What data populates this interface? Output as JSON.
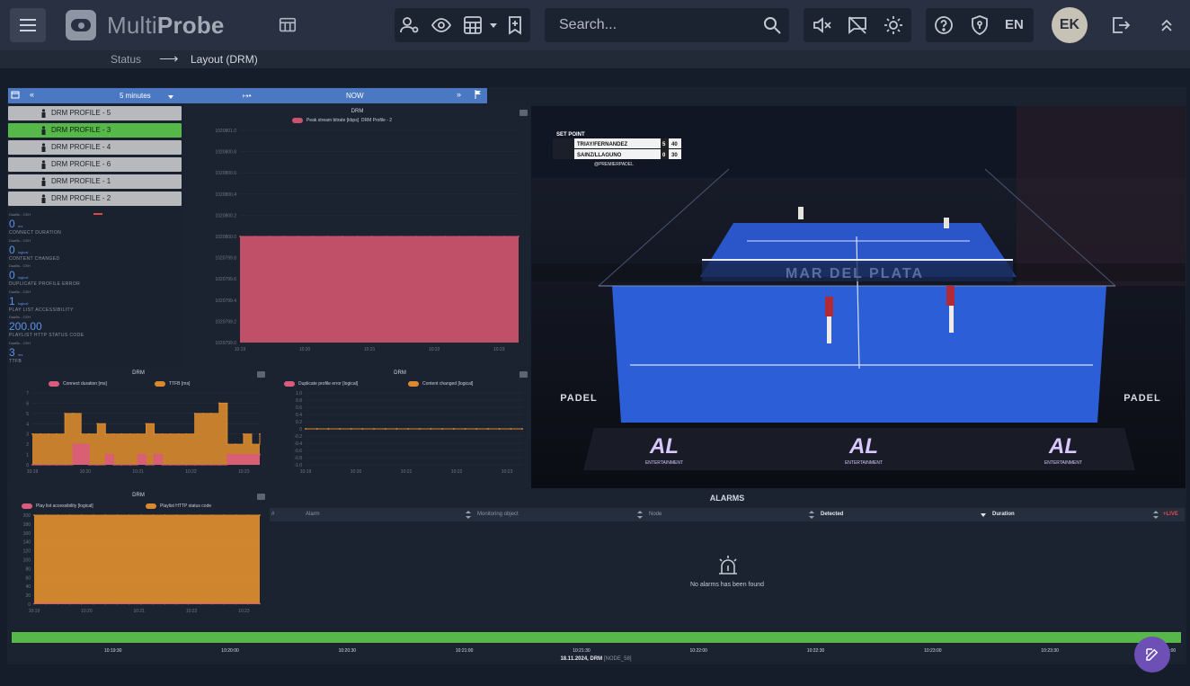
{
  "app": {
    "brand_light": "Multi",
    "brand_bold": "Probe",
    "search_placeholder": "Search...",
    "language": "EN",
    "user_initials": "EK"
  },
  "breadcrumb": {
    "parent": "Status",
    "current": "Layout (DRM)"
  },
  "timebar": {
    "range": "5 minutes",
    "now_label": "NOW"
  },
  "profiles": [
    {
      "label": "DRM PROFILE - 5",
      "active": false
    },
    {
      "label": "DRM PROFILE - 3",
      "active": true
    },
    {
      "label": "DRM PROFILE - 4",
      "active": false
    },
    {
      "label": "DRM PROFILE - 6",
      "active": false
    },
    {
      "label": "DRM PROFILE - 1",
      "active": false
    },
    {
      "label": "DRM PROFILE - 2",
      "active": false
    }
  ],
  "metrics": [
    {
      "small": "DaaBs - CEH",
      "value": "0",
      "unit": "ms",
      "label": "CONNECT DURATION",
      "flag": true
    },
    {
      "small": "DaaBs - CEH",
      "value": "0",
      "unit": "logical",
      "label": "CONTENT CHANGED",
      "flag": false
    },
    {
      "small": "DaaBs - CEH",
      "value": "0",
      "unit": "logical",
      "label": "DUPLICATE PROFILE ERROR",
      "flag": false
    },
    {
      "small": "DaaBs - CEH",
      "value": "1",
      "unit": "logical",
      "label": "PLAY LIST ACCESSIBILITY",
      "flag": false
    },
    {
      "small": "DaaBs - CEH",
      "value": "200.00",
      "unit": "",
      "label": "PLAYLIST HTTP STATUS CODE",
      "flag": false
    },
    {
      "small": "DaaBs - CEH",
      "value": "3",
      "unit": "ms",
      "label": "TTFB",
      "flag": false
    }
  ],
  "chart_data": [
    {
      "type": "area",
      "title": "DRM",
      "series": [
        {
          "name": "Peak stream bitrate [kbps]",
          "legend_suffix": "DRM Profile - 2",
          "color": "#c9536c",
          "values": [
            1020800,
            1020800,
            1020800,
            1020800,
            1020800,
            1020800,
            1020800,
            1020800,
            1020800,
            1020800,
            1020800,
            1020800,
            1020800,
            1020800,
            1020800,
            1020800,
            1020800,
            1020800,
            1020800,
            1020800
          ]
        }
      ],
      "y_ticks": [
        "1020801.0",
        "1020800.8",
        "1020800.6",
        "1020800.4",
        "1020800.2",
        "1020800.0",
        "1020799.8",
        "1020799.6",
        "1020799.4",
        "1020799.2",
        "1020799.0"
      ],
      "ylim": [
        1020799.0,
        1020801.0
      ],
      "x_ticks": [
        "10:19",
        "10:20",
        "10:21",
        "10:22",
        "10:23"
      ]
    },
    {
      "type": "area",
      "title": "DRM",
      "series": [
        {
          "name": "Connect duration [ms]",
          "color": "#d95c7c",
          "values": [
            0,
            0,
            0,
            0,
            0,
            2,
            2,
            0,
            0,
            1,
            0,
            0,
            0,
            1,
            0,
            1,
            0,
            0,
            0,
            0,
            0,
            0,
            0,
            0,
            1,
            1,
            1,
            1,
            1
          ]
        },
        {
          "name": "TTFB [ms]",
          "color": "#d98a2e",
          "values": [
            3,
            3,
            3,
            3,
            5,
            5,
            3,
            3,
            4,
            3,
            3,
            3,
            3,
            3,
            4,
            3,
            3,
            3,
            3,
            3,
            5,
            5,
            5,
            6,
            2,
            2,
            3,
            2,
            3
          ]
        }
      ],
      "y_ticks": [
        "7",
        "6",
        "5",
        "4",
        "3",
        "2",
        "1",
        "0"
      ],
      "ylim": [
        0,
        7
      ],
      "x_ticks": [
        "10:19",
        "10:20",
        "10:21",
        "10:22",
        "10:23"
      ]
    },
    {
      "type": "line",
      "title": "DRM",
      "series": [
        {
          "name": "Duplicate profile error [logical]",
          "color": "#d95c7c",
          "values": [
            0,
            0,
            0,
            0,
            0,
            0,
            0,
            0,
            0,
            0,
            0,
            0,
            0,
            0,
            0,
            0,
            0,
            0,
            0,
            0
          ]
        },
        {
          "name": "Content changed [logical]",
          "color": "#d98a2e",
          "values": [
            0,
            0,
            0,
            0,
            0,
            0,
            0,
            0,
            0,
            0,
            0,
            0,
            0,
            0,
            0,
            0,
            0,
            0,
            0,
            0
          ]
        }
      ],
      "y_ticks": [
        "1.0",
        "0.8",
        "0.6",
        "0.4",
        "0.2",
        "0",
        "-0.2",
        "-0.4",
        "-0.6",
        "-0.8",
        "-1.0"
      ],
      "ylim": [
        -1.0,
        1.0
      ],
      "x_ticks": [
        "10:19",
        "10:20",
        "10:21",
        "10:22",
        "10:23"
      ]
    },
    {
      "type": "area",
      "title": "DRM",
      "series": [
        {
          "name": "Play list accessibility [logical]",
          "color": "#d95c7c",
          "values": [
            1,
            1,
            1,
            1,
            1,
            1,
            1,
            1,
            1,
            1,
            1,
            1,
            1,
            1,
            1,
            1,
            1,
            1,
            1,
            1
          ]
        },
        {
          "name": "Playlist HTTP status code",
          "color": "#d98a2e",
          "values": [
            200,
            200,
            200,
            200,
            200,
            200,
            200,
            200,
            200,
            200,
            200,
            200,
            200,
            200,
            200,
            200,
            200,
            200,
            200,
            200
          ]
        }
      ],
      "y_ticks": [
        "200",
        "180",
        "160",
        "140",
        "120",
        "100",
        "80",
        "60",
        "40",
        "20",
        "0"
      ],
      "ylim": [
        0,
        200
      ],
      "x_ticks": [
        "10:19",
        "10:20",
        "10:21",
        "10:22",
        "10:23"
      ]
    }
  ],
  "video": {
    "score_label": "SET POINT",
    "team1": "TRIAY/FERNANDEZ",
    "team1_set": "5",
    "team1_points": "40",
    "team2": "SAINZ/LLAGUNO",
    "team2_set": "0",
    "team2_points": "30",
    "handle": "@PREMIERPADEL",
    "court_text": "MAR DEL PLATA",
    "sponsor_left": "PADEL",
    "sponsor_right": "PADEL",
    "board_logo": "AL",
    "board_sub": "ENTERTAINMENT"
  },
  "alarms": {
    "title": "ALARMS",
    "columns": [
      "#",
      "Alarm",
      "Monitoring object",
      "Node",
      "Detected",
      "Duration"
    ],
    "live": "+LIVE",
    "empty": "No alarms has been found"
  },
  "timeline": {
    "ticks": [
      "10:19:30",
      "10:20:00",
      "10:20:30",
      "10:21:00",
      "10:21:30",
      "10:22:00",
      "10:22:30",
      "10:23:00",
      "10:23:30",
      "10:24:00"
    ],
    "footer_date": "18.11.2024, DRM",
    "footer_node": "[NODE_58]"
  }
}
